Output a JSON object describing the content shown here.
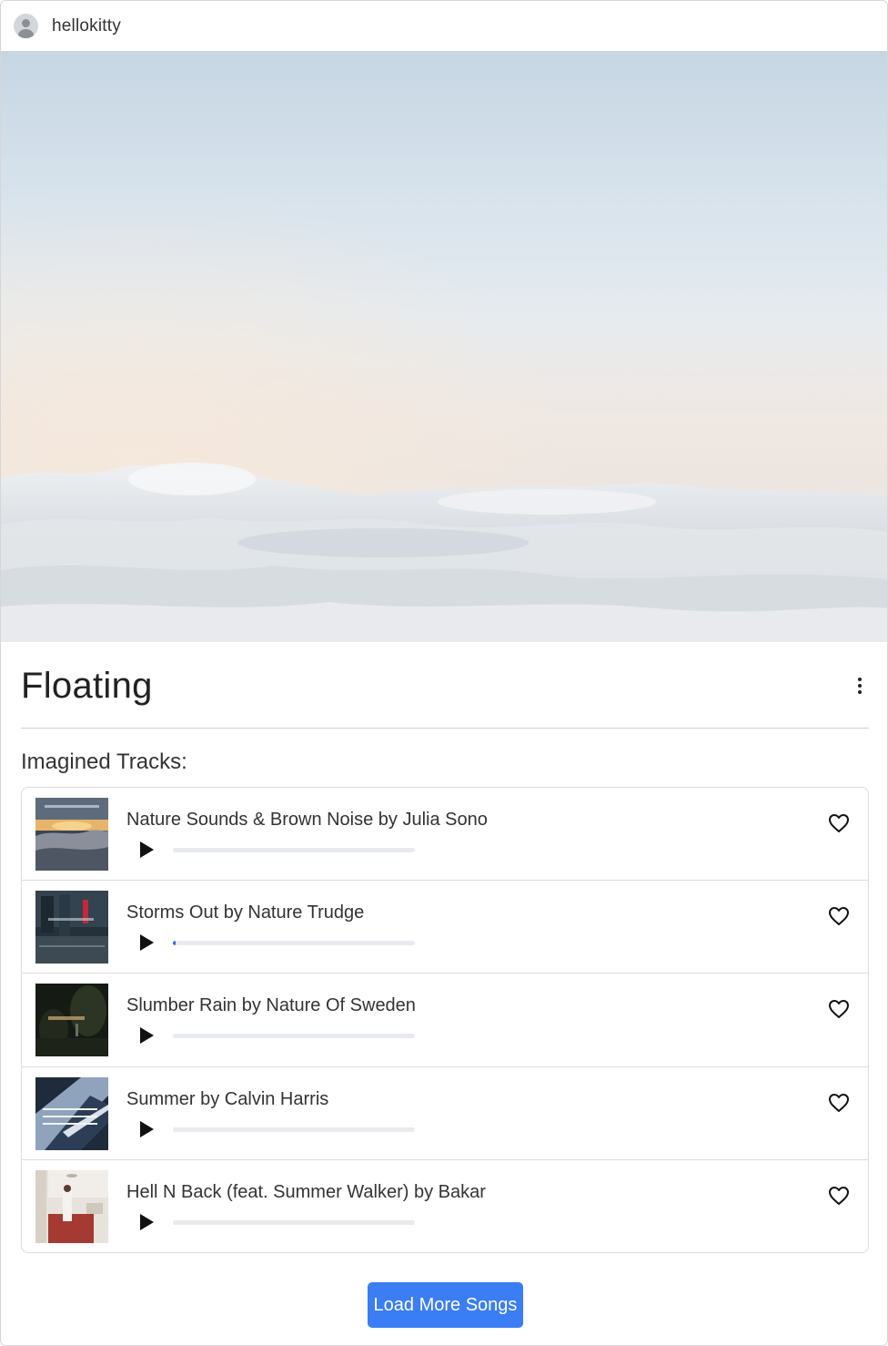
{
  "user": {
    "name": "hellokitty"
  },
  "playlist": {
    "title": "Floating",
    "section_label": "Imagined Tracks:"
  },
  "tracks": [
    {
      "label": "Nature Sounds & Brown Noise by Julia Sono",
      "progress": 0,
      "liked": false
    },
    {
      "label": "Storms Out by Nature Trudge",
      "progress": 0.01,
      "liked": false
    },
    {
      "label": "Slumber Rain by Nature Of Sweden",
      "progress": 0,
      "liked": false
    },
    {
      "label": "Summer by Calvin Harris",
      "progress": 0,
      "liked": false
    },
    {
      "label": "Hell N Back (feat. Summer Walker) by Bakar",
      "progress": 0,
      "liked": false
    }
  ],
  "load_more_label": "Load More Songs",
  "colors": {
    "accent": "#3b7df2",
    "progress_fill": "#2f6fe0",
    "progress_track": "#e9eaef"
  },
  "icons": {
    "avatar": "user-avatar-icon",
    "menu": "more-vertical-icon",
    "play": "play-icon",
    "like": "heart-outline-icon"
  }
}
